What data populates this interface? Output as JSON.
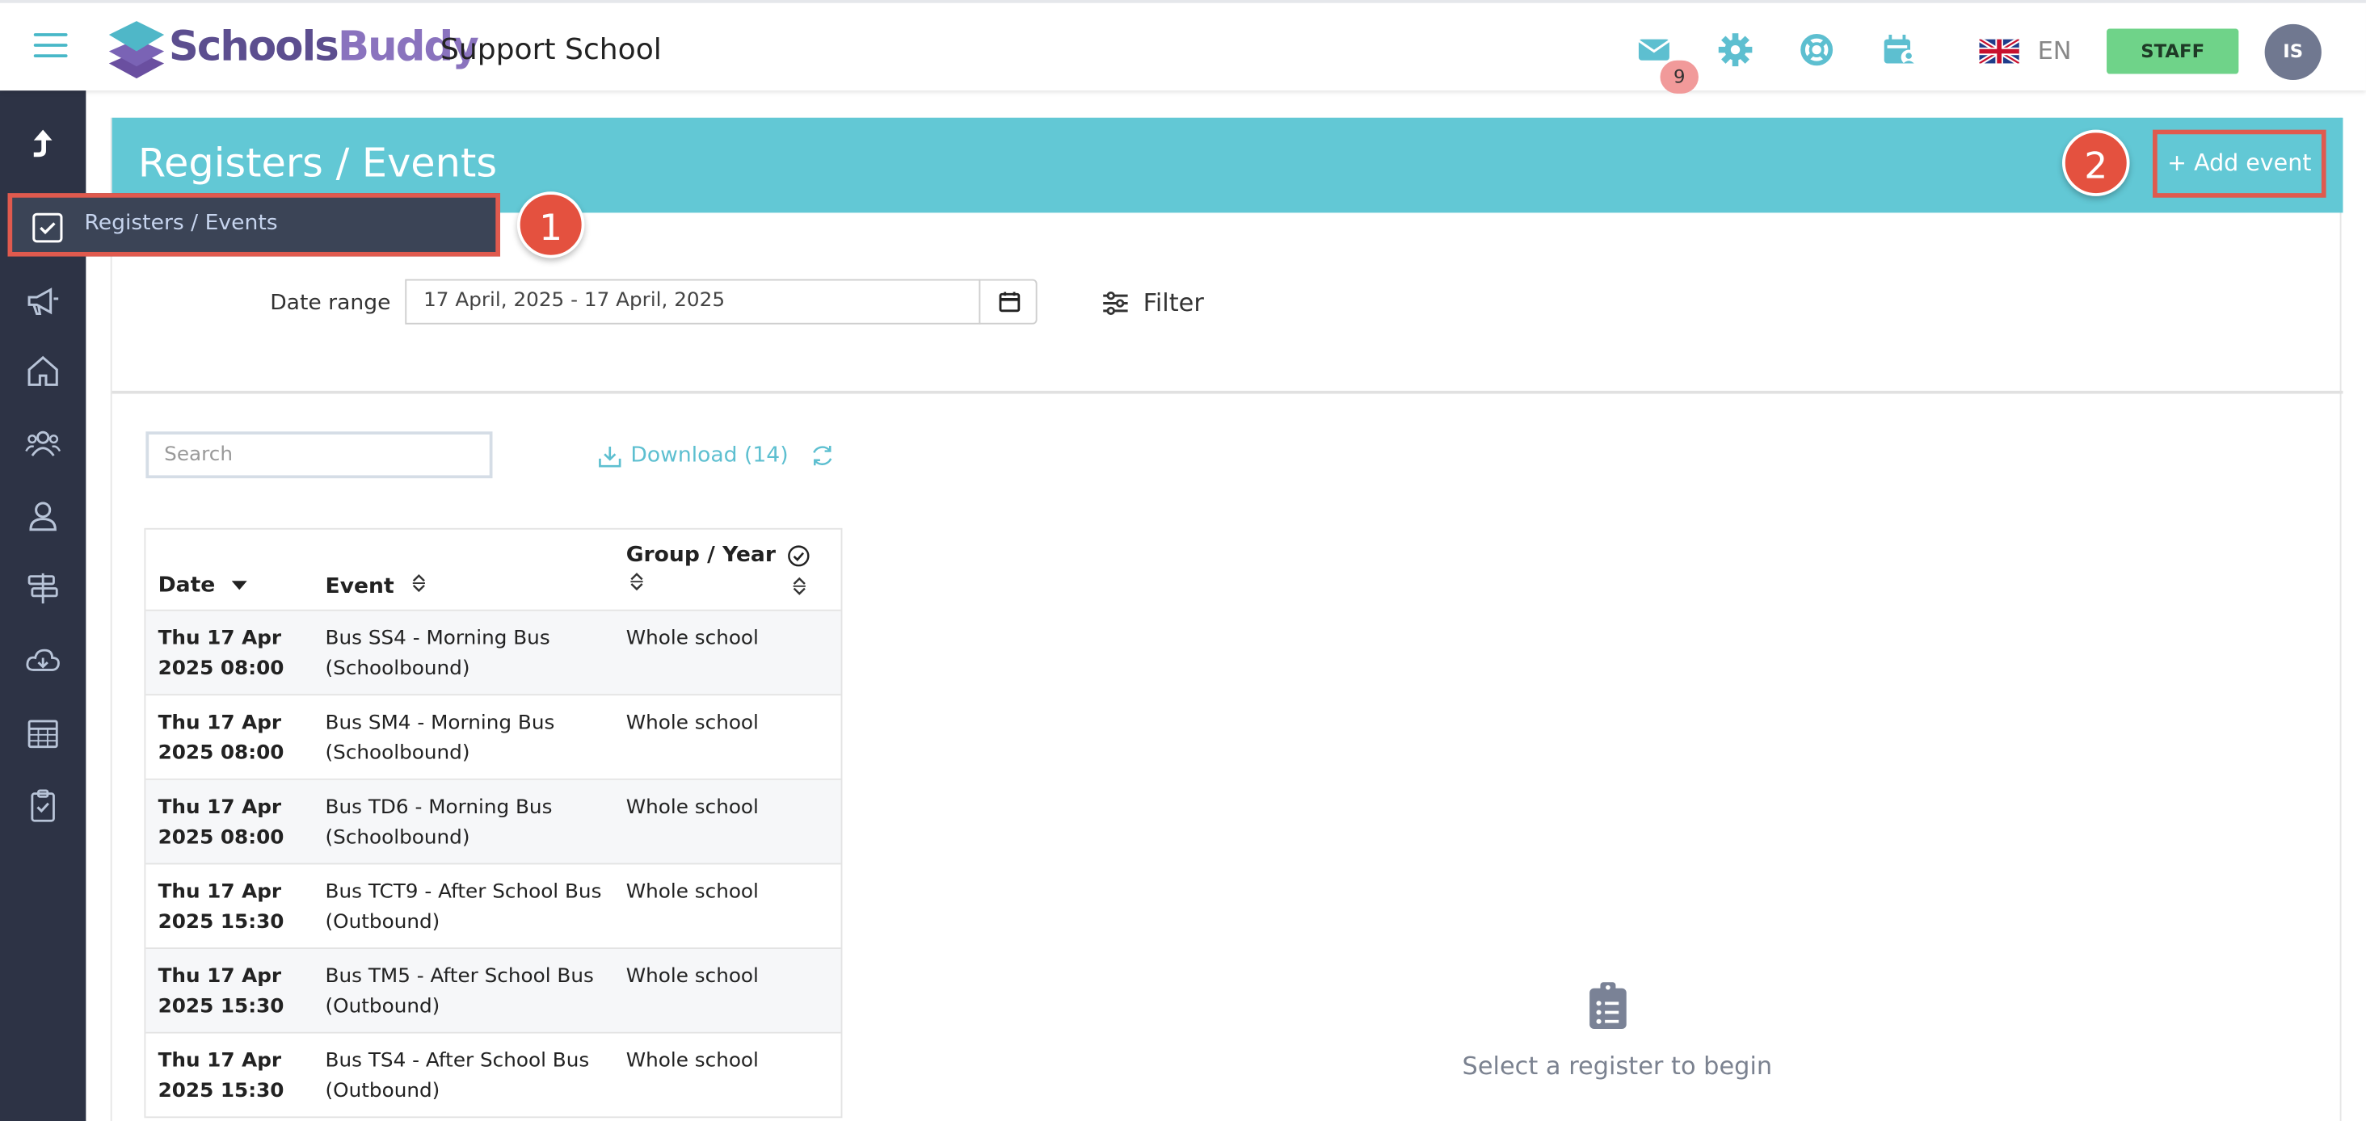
{
  "app": {
    "brand_part1": "Schools",
    "brand_part2": "Buddy",
    "school_name": "Support School"
  },
  "topbar": {
    "icons": [
      "envelope-icon",
      "gear-icon",
      "lifebuoy-icon",
      "calendar-user-icon"
    ],
    "unread_count": "9",
    "language": "EN",
    "role_label": "STAFF",
    "user_initials": "IS"
  },
  "sidebar": {
    "active_label": "Registers / Events",
    "icons": [
      "up-arrow-icon",
      "checkbox-icon",
      "megaphone-icon",
      "home-icon",
      "people-icon",
      "person-icon",
      "signpost-icon",
      "cloud-download-icon",
      "table-calendar-icon",
      "clipboard-check-icon"
    ]
  },
  "annotations": {
    "callout_1": "1",
    "callout_2": "2"
  },
  "page": {
    "title": "Registers / Events",
    "add_event_label": "+ Add event"
  },
  "filters": {
    "date_range_label": "Date range",
    "date_range_value": "17 April, 2025 - 17 April, 2025",
    "filter_label": "Filter"
  },
  "list": {
    "search_placeholder": "Search",
    "download_label": "Download (14)"
  },
  "table": {
    "headers": {
      "date": "Date",
      "event": "Event",
      "group": "Group / Year"
    },
    "rows": [
      {
        "date_line1": "Thu 17 Apr",
        "date_line2": "2025 08:00",
        "event_line1": "Bus SS4 - Morning Bus",
        "event_line2": "(Schoolbound)",
        "group": "Whole school"
      },
      {
        "date_line1": "Thu 17 Apr",
        "date_line2": "2025 08:00",
        "event_line1": "Bus SM4 - Morning Bus",
        "event_line2": "(Schoolbound)",
        "group": "Whole school"
      },
      {
        "date_line1": "Thu 17 Apr",
        "date_line2": "2025 08:00",
        "event_line1": "Bus TD6 - Morning Bus",
        "event_line2": "(Schoolbound)",
        "group": "Whole school"
      },
      {
        "date_line1": "Thu 17 Apr",
        "date_line2": "2025 15:30",
        "event_line1": "Bus TCT9 - After School Bus",
        "event_line2": "(Outbound)",
        "group": "Whole school"
      },
      {
        "date_line1": "Thu 17 Apr",
        "date_line2": "2025 15:30",
        "event_line1": "Bus TM5 - After School Bus",
        "event_line2": "(Outbound)",
        "group": "Whole school"
      },
      {
        "date_line1": "Thu 17 Apr",
        "date_line2": "2025 15:30",
        "event_line1": "Bus TS4 - After School Bus",
        "event_line2": "(Outbound)",
        "group": "Whole school"
      }
    ]
  },
  "empty_state": {
    "message": "Select a register to begin"
  },
  "colors": {
    "accent_teal": "#62c8d5",
    "sidebar_bg": "#2d3345",
    "staff_green": "#6fd389",
    "callout_red": "#e4513f"
  }
}
